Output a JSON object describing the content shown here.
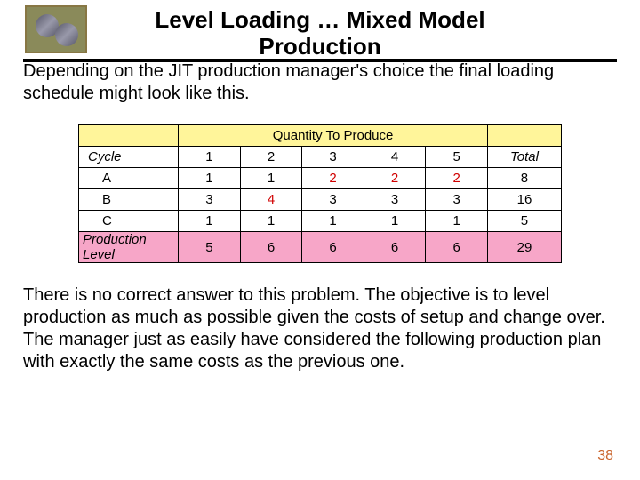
{
  "title": {
    "line1": "Level Loading … Mixed Model",
    "line2": "Production"
  },
  "para1": "Depending on the JIT production manager's choice the final loading schedule might look like this.",
  "para2": "There is no correct answer to this problem.  The objective is to level production as much as possible given the costs of setup and change over.  The manager just as easily have considered the following production plan with exactly the same costs as the previous one.",
  "page_number": "38",
  "chart_data": {
    "type": "table",
    "title": "Quantity To Produce",
    "row_header_label": "Cycle",
    "total_label": "Total",
    "categories": [
      "1",
      "2",
      "3",
      "4",
      "5"
    ],
    "series": [
      {
        "name": "A",
        "values": [
          1,
          1,
          2,
          2,
          2
        ],
        "total": 8
      },
      {
        "name": "B",
        "values": [
          3,
          4,
          3,
          3,
          3
        ],
        "total": 16
      },
      {
        "name": "C",
        "values": [
          1,
          1,
          1,
          1,
          1
        ],
        "total": 5
      }
    ],
    "summary_row": {
      "name": "Production Level",
      "values": [
        5,
        6,
        6,
        6,
        6
      ],
      "total": 29
    },
    "highlight_cells": [
      {
        "row": "A",
        "col": "3"
      },
      {
        "row": "A",
        "col": "4"
      },
      {
        "row": "A",
        "col": "5"
      },
      {
        "row": "B",
        "col": "2"
      }
    ]
  }
}
